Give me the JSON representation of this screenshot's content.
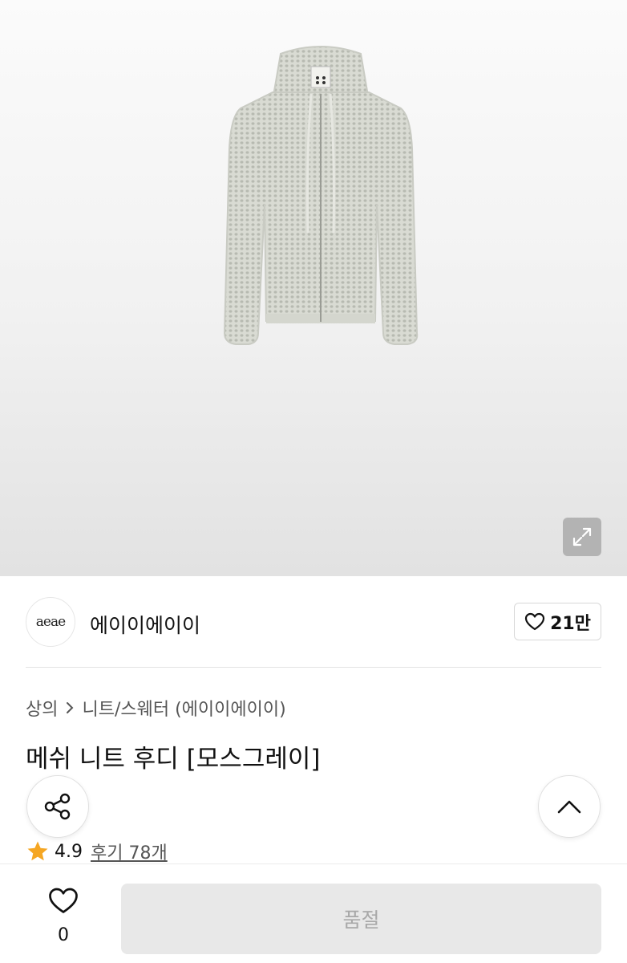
{
  "brand": {
    "logo_text": "aeae",
    "name": "에이이에이이",
    "like_count": "21만"
  },
  "breadcrumb": {
    "category": "상의",
    "subcategory": "니트/스웨터 (에이이에이이)"
  },
  "product": {
    "title": "메쉬 니트 후디 [모스그레이]",
    "rating": "4.9",
    "review_label": "후기 78개"
  },
  "bottom_bar": {
    "wish_count": "0",
    "cta_label": "품절"
  },
  "icons": {
    "expand": "expand-icon",
    "heart": "heart-icon",
    "share": "share-icon",
    "scroll_top": "chevron-up-icon",
    "star": "star-icon",
    "breadcrumb_sep": "chevron-right-icon"
  },
  "colors": {
    "star": "#F5A623",
    "soldout_bg": "#E8E8E8",
    "soldout_text": "#A8A8A8"
  }
}
